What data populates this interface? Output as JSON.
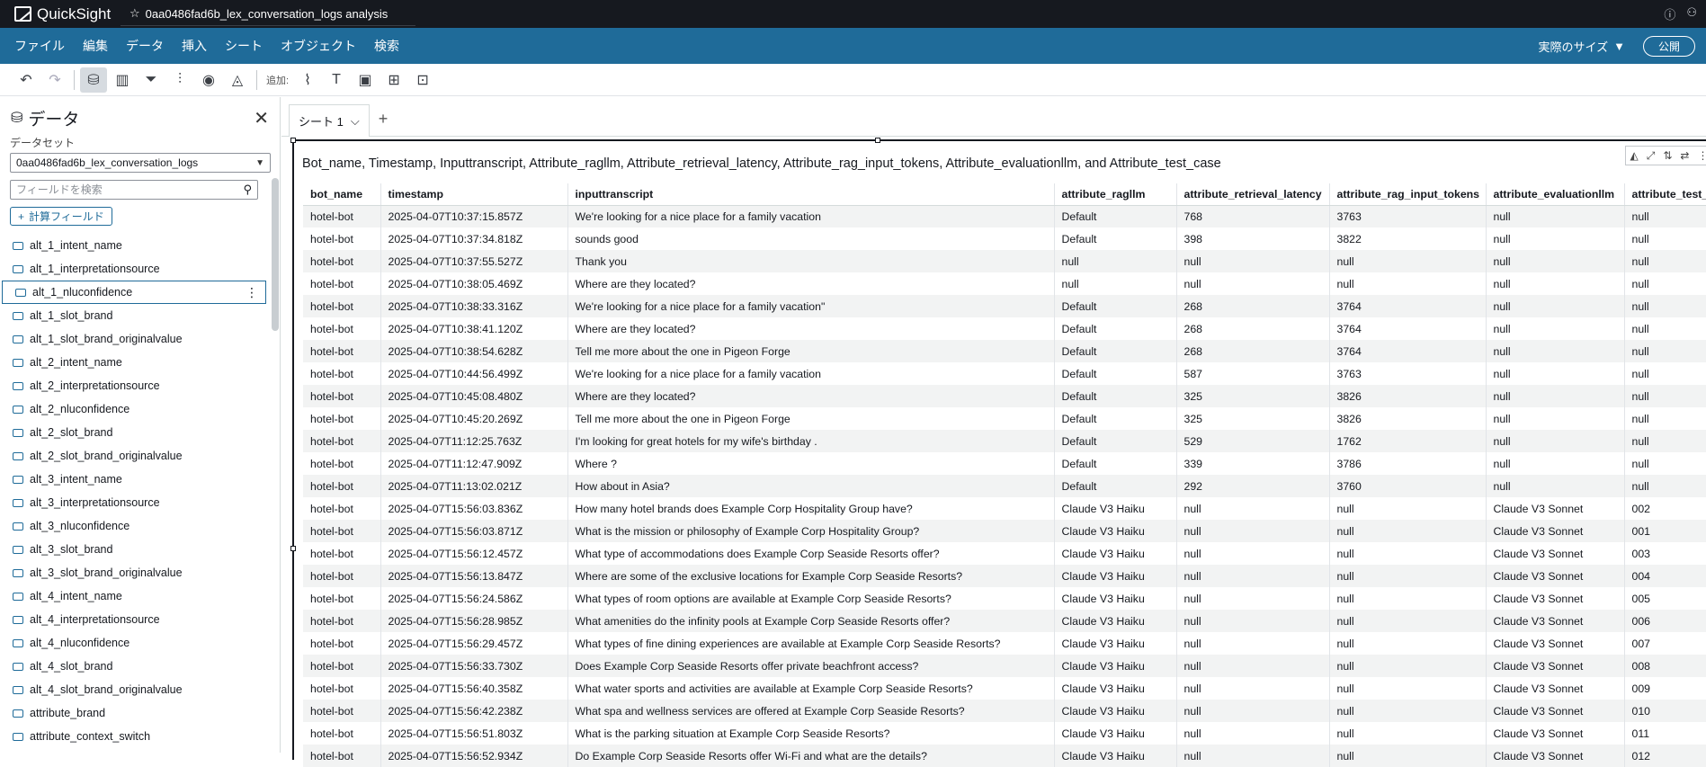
{
  "app": {
    "name": "QuickSight",
    "analysis_title": "0aa0486fad6b_lex_conversation_logs analysis"
  },
  "menu": {
    "items": [
      "ファイル",
      "編集",
      "データ",
      "挿入",
      "シート",
      "オブジェクト",
      "検索"
    ],
    "fit_label": "実際のサイズ",
    "publish_label": "公開"
  },
  "toolbar": {
    "add_label": "追加:"
  },
  "sidebar": {
    "title": "データ",
    "dataset_label": "データセット",
    "dataset_value": "0aa0486fad6b_lex_conversation_logs",
    "search_placeholder": "フィールドを検索",
    "add_calc_label": "計算フィールド",
    "fields": [
      "alt_1_intent_name",
      "alt_1_interpretationsource",
      "alt_1_nluconfidence",
      "alt_1_slot_brand",
      "alt_1_slot_brand_originalvalue",
      "alt_2_intent_name",
      "alt_2_interpretationsource",
      "alt_2_nluconfidence",
      "alt_2_slot_brand",
      "alt_2_slot_brand_originalvalue",
      "alt_3_intent_name",
      "alt_3_interpretationsource",
      "alt_3_nluconfidence",
      "alt_3_slot_brand",
      "alt_3_slot_brand_originalvalue",
      "alt_4_intent_name",
      "alt_4_interpretationsource",
      "alt_4_nluconfidence",
      "alt_4_slot_brand",
      "alt_4_slot_brand_originalvalue",
      "attribute_brand",
      "attribute_context_switch"
    ],
    "selected_field_index": 2
  },
  "sheet": {
    "tab_label": "シート 1"
  },
  "visual": {
    "title": "Bot_name, Timestamp, Inputtranscript, Attribute_ragllm, Attribute_retrieval_latency, Attribute_rag_input_tokens, Attribute_evaluationllm, and Attribute_test_case",
    "columns": [
      "bot_name",
      "timestamp",
      "inputtranscript",
      "attribute_ragllm",
      "attribute_retrieval_latency",
      "attribute_rag_input_tokens",
      "attribute_evaluationllm",
      "attribute_test_case"
    ],
    "rows": [
      [
        "hotel-bot",
        "2025-04-07T10:37:15.857Z",
        "We're looking for a nice place for a family vacation",
        "Default",
        "768",
        "3763",
        "null",
        "null"
      ],
      [
        "hotel-bot",
        "2025-04-07T10:37:34.818Z",
        "sounds good",
        "Default",
        "398",
        "3822",
        "null",
        "null"
      ],
      [
        "hotel-bot",
        "2025-04-07T10:37:55.527Z",
        "Thank you",
        "null",
        "null",
        "null",
        "null",
        "null"
      ],
      [
        "hotel-bot",
        "2025-04-07T10:38:05.469Z",
        "Where are they located?",
        "null",
        "null",
        "null",
        "null",
        "null"
      ],
      [
        "hotel-bot",
        "2025-04-07T10:38:33.316Z",
        "We're looking for a nice place for a family vacation\"",
        "Default",
        "268",
        "3764",
        "null",
        "null"
      ],
      [
        "hotel-bot",
        "2025-04-07T10:38:41.120Z",
        "Where are they located?",
        "Default",
        "268",
        "3764",
        "null",
        "null"
      ],
      [
        "hotel-bot",
        "2025-04-07T10:38:54.628Z",
        "Tell me more about the one in Pigeon Forge",
        "Default",
        "268",
        "3764",
        "null",
        "null"
      ],
      [
        "hotel-bot",
        "2025-04-07T10:44:56.499Z",
        "We're looking for a nice place for a family vacation",
        "Default",
        "587",
        "3763",
        "null",
        "null"
      ],
      [
        "hotel-bot",
        "2025-04-07T10:45:08.480Z",
        "Where are they located?",
        "Default",
        "325",
        "3826",
        "null",
        "null"
      ],
      [
        "hotel-bot",
        "2025-04-07T10:45:20.269Z",
        "Tell me more about the one in Pigeon Forge",
        "Default",
        "325",
        "3826",
        "null",
        "null"
      ],
      [
        "hotel-bot",
        "2025-04-07T11:12:25.763Z",
        "I'm looking for great hotels for my wife's birthday .",
        "Default",
        "529",
        "1762",
        "null",
        "null"
      ],
      [
        "hotel-bot",
        "2025-04-07T11:12:47.909Z",
        "Where ?",
        "Default",
        "339",
        "3786",
        "null",
        "null"
      ],
      [
        "hotel-bot",
        "2025-04-07T11:13:02.021Z",
        "How about in Asia?",
        "Default",
        "292",
        "3760",
        "null",
        "null"
      ],
      [
        "hotel-bot",
        "2025-04-07T15:56:03.836Z",
        "How many hotel brands does Example Corp Hospitality Group have?",
        "Claude V3 Haiku",
        "null",
        "null",
        "Claude V3 Sonnet",
        "002"
      ],
      [
        "hotel-bot",
        "2025-04-07T15:56:03.871Z",
        "What is the mission or philosophy of Example Corp Hospitality Group?",
        "Claude V3 Haiku",
        "null",
        "null",
        "Claude V3 Sonnet",
        "001"
      ],
      [
        "hotel-bot",
        "2025-04-07T15:56:12.457Z",
        "What type of accommodations does Example Corp Seaside Resorts offer?",
        "Claude V3 Haiku",
        "null",
        "null",
        "Claude V3 Sonnet",
        "003"
      ],
      [
        "hotel-bot",
        "2025-04-07T15:56:13.847Z",
        "Where are some of the exclusive locations for Example Corp Seaside Resorts?",
        "Claude V3 Haiku",
        "null",
        "null",
        "Claude V3 Sonnet",
        "004"
      ],
      [
        "hotel-bot",
        "2025-04-07T15:56:24.586Z",
        "What types of room options are available at Example Corp Seaside Resorts?",
        "Claude V3 Haiku",
        "null",
        "null",
        "Claude V3 Sonnet",
        "005"
      ],
      [
        "hotel-bot",
        "2025-04-07T15:56:28.985Z",
        "What amenities do the infinity pools at Example Corp Seaside Resorts offer?",
        "Claude V3 Haiku",
        "null",
        "null",
        "Claude V3 Sonnet",
        "006"
      ],
      [
        "hotel-bot",
        "2025-04-07T15:56:29.457Z",
        "What types of fine dining experiences are available at Example Corp Seaside Resorts?",
        "Claude V3 Haiku",
        "null",
        "null",
        "Claude V3 Sonnet",
        "007"
      ],
      [
        "hotel-bot",
        "2025-04-07T15:56:33.730Z",
        "Does Example Corp Seaside Resorts offer private beachfront access?",
        "Claude V3 Haiku",
        "null",
        "null",
        "Claude V3 Sonnet",
        "008"
      ],
      [
        "hotel-bot",
        "2025-04-07T15:56:40.358Z",
        "What water sports and activities are available at Example Corp Seaside Resorts?",
        "Claude V3 Haiku",
        "null",
        "null",
        "Claude V3 Sonnet",
        "009"
      ],
      [
        "hotel-bot",
        "2025-04-07T15:56:42.238Z",
        "What spa and wellness services are offered at Example Corp Seaside Resorts?",
        "Claude V3 Haiku",
        "null",
        "null",
        "Claude V3 Sonnet",
        "010"
      ],
      [
        "hotel-bot",
        "2025-04-07T15:56:51.803Z",
        "What is the parking situation at Example Corp Seaside Resorts?",
        "Claude V3 Haiku",
        "null",
        "null",
        "Claude V3 Sonnet",
        "011"
      ],
      [
        "hotel-bot",
        "2025-04-07T15:56:52.934Z",
        "Do Example Corp Seaside Resorts offer Wi-Fi and what are the details?",
        "Claude V3 Haiku",
        "null",
        "null",
        "Claude V3 Sonnet",
        "012"
      ]
    ]
  },
  "colors": {
    "topbar": "#16191f",
    "menubar": "#1f6b99",
    "accent": "#1f6b99"
  }
}
